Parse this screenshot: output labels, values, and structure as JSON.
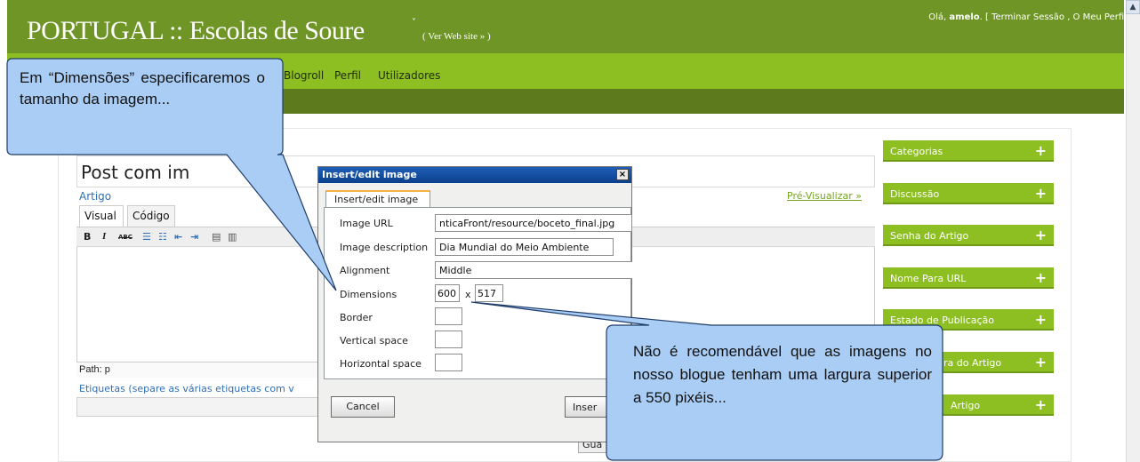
{
  "header": {
    "site_title": "PORTUGAL :: Escolas de Soure",
    "dropdown_arrow": "˅",
    "view_site": "( Ver Web site » )",
    "user_greeting": "Olá,",
    "user_name": "amelo",
    "user_links": ". [ Terminar Sessão , O Meu Perfil ]"
  },
  "nav": {
    "items": [
      "Blogroll",
      "Perfil",
      "Utilizadores"
    ]
  },
  "editor": {
    "post_title": "Post com im",
    "artigo_label": "Artigo",
    "preview_link": "Pré-Visualizar »",
    "tab_visual": "Visual",
    "tab_codigo": "Código",
    "toolbar": {
      "bold": "B",
      "italic": "I",
      "strike": "ABC",
      "ul": "☰",
      "ol": "☷",
      "outdent": "⇤",
      "indent": "⇥",
      "align_left": "▤",
      "align_center": "▥"
    },
    "path": "Path: p",
    "tags_label": "Etiquetas (separe as várias etiquetas com v",
    "save_button": "Gua"
  },
  "sidebar": {
    "items": [
      {
        "label": "Categorias",
        "plus": "+"
      },
      {
        "label": "Discussão",
        "plus": "+"
      },
      {
        "label": "Senha do Artigo",
        "plus": "+"
      },
      {
        "label": "Nome Para URL",
        "plus": "+"
      },
      {
        "label": "Estado de Publicação",
        "plus": "+"
      },
      {
        "label": "ra do Artigo",
        "plus": "+"
      },
      {
        "label": "Artigo",
        "plus": "+"
      }
    ]
  },
  "dialog": {
    "title": "Insert/edit image",
    "close": "×",
    "tab": "Insert/edit image",
    "fields": {
      "image_url_label": "Image URL",
      "image_url_value": "nticaFront/resource/boceto_final.jpg",
      "description_label": "Image description",
      "description_value": "Dia Mundial do Meio Ambiente",
      "alignment_label": "Alignment",
      "alignment_value": "Middle",
      "dimensions_label": "Dimensions",
      "width_value": "600",
      "times": "x",
      "height_value": "517",
      "border_label": "Border",
      "vspace_label": "Vertical space",
      "hspace_label": "Horizontal space"
    },
    "cancel_button": "Cancel",
    "insert_button": "Inser"
  },
  "callouts": {
    "top_left": "Em “Dimensões” especificaremos o tamanho da imagem...",
    "bottom_right": "Não é recomendável que as imagens no nosso blogue tenham uma largura superior a 550 pixéis..."
  },
  "colors": {
    "header_green": "#6e9525",
    "nav_green": "#8dbe22",
    "callout_fill": "#a9cdf5",
    "callout_stroke": "#1f3d6b"
  }
}
